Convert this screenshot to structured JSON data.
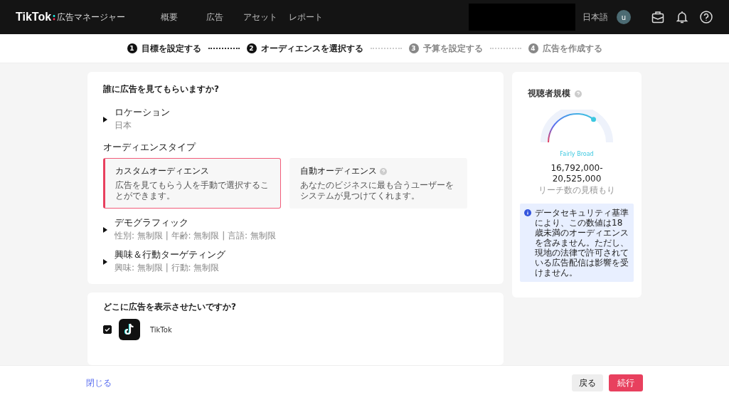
{
  "header": {
    "logo": "TikTok",
    "product": "広告マネージャー",
    "nav": [
      {
        "label": "概要",
        "selected": false
      },
      {
        "label": "広告",
        "selected": false
      },
      {
        "label": "アセット",
        "selected": false
      },
      {
        "label": "レポート",
        "selected": false
      }
    ],
    "language": "日本語",
    "avatar": "u"
  },
  "steps": [
    {
      "number": "1",
      "label": "目標を設定する",
      "enabled": true
    },
    {
      "number": "2",
      "label": "オーディエンスを選択する",
      "enabled": true
    },
    {
      "number": "3",
      "label": "予算を設定する",
      "enabled": false
    },
    {
      "number": "4",
      "label": "広告を作成する",
      "enabled": false
    }
  ],
  "targeting": {
    "title": "誰に広告を見てもらいますか?",
    "location": {
      "label": "ロケーション",
      "summary": "日本",
      "expanded": false
    },
    "audience_type_heading": "オーディエンスタイプ",
    "audience_types": [
      {
        "title": "カスタムオーディエンス",
        "description": "広告を見てもらう人を手動で選択することができます。",
        "selected": true,
        "help": false
      },
      {
        "title": "自動オーディエンス",
        "description": "あなたのビジネスに最も合うユーザーをシステムが見つけてくれます。",
        "selected": false,
        "help": true
      }
    ],
    "sections": [
      {
        "label": "デモグラフィック",
        "summary": "性別: 無制限 | 年齢: 無制限 | 言語: 無制限",
        "expanded": false
      },
      {
        "label": "興味＆行動ターゲティング",
        "summary": "興味: 無制限 | 行動: 無制限",
        "expanded": false
      }
    ]
  },
  "placement": {
    "title": "どこに広告を表示させたいですか?",
    "options": [
      {
        "label": "TikTok",
        "checked": true
      }
    ]
  },
  "audience_size": {
    "title": "視聴者規模",
    "level": 0.7,
    "rating": "Fairly Broad",
    "range": "16,792,000-20,525,000",
    "caption": "リーチ数の見積もり",
    "notice": "データセキュリティ基準により、この数値は18歳未満のオーディエンスを含みません。ただし、現地の法律で許可されている広告配信は影響を受けません。"
  },
  "footer": {
    "close": "閉じる",
    "back": "戻る",
    "continue": "続行"
  }
}
